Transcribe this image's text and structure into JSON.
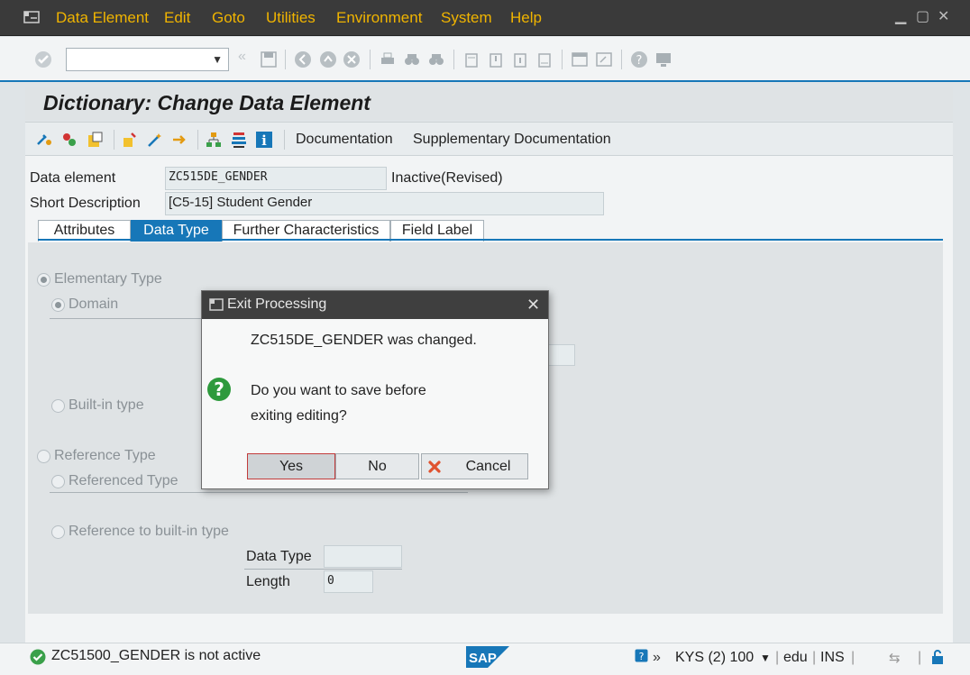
{
  "menu": {
    "items": [
      "Data Element",
      "Edit",
      "Goto",
      "Utilities",
      "Environment",
      "System",
      "Help"
    ]
  },
  "page": {
    "title": "Dictionary: Change Data Element"
  },
  "app_toolbar": {
    "documentation": "Documentation",
    "supplementary": "Supplementary Documentation"
  },
  "header_fields": {
    "data_element_label": "Data element",
    "data_element_value": "ZC515DE_GENDER",
    "data_element_status": "Inactive(Revised)",
    "short_desc_label": "Short Description",
    "short_desc_value": "[C5-15] Student Gender"
  },
  "tabs": [
    "Attributes",
    "Data Type",
    "Further Characteristics",
    "Field Label"
  ],
  "panel": {
    "elementary_type": "Elementary Type",
    "domain": "Domain",
    "builtin_type": "Built-in type",
    "reference_type": "Reference Type",
    "referenced_type": "Referenced Type",
    "reference_builtin": "Reference to built-in type",
    "data_type_label": "Data Type",
    "data_type_value": "",
    "length_label": "Length",
    "length_value": "0"
  },
  "dialog": {
    "title": "Exit Processing",
    "line1": "ZC515DE_GENDER was changed.",
    "line2": "Do you want to save before",
    "line3": "exiting editing?",
    "yes": "Yes",
    "no": "No",
    "cancel": "Cancel"
  },
  "status": {
    "message": "ZC51500_GENDER is not active",
    "session": "KYS (2) 100",
    "server": "edu",
    "mode": "INS",
    "brand": "SAP"
  },
  "colors": {
    "menu_text": "#f0b400",
    "accent": "#1777b8",
    "success": "#3aa04a"
  }
}
